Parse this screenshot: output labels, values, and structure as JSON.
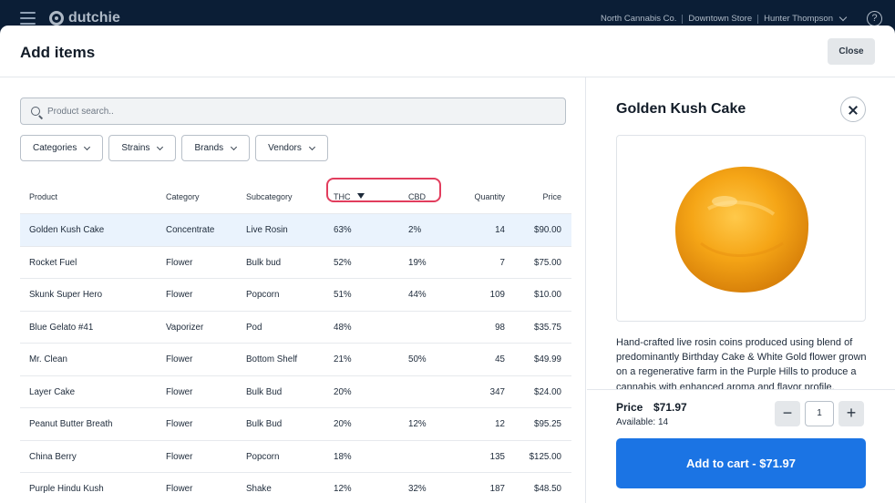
{
  "topbar": {
    "brand": "dutchie",
    "company": "North Cannabis Co.",
    "store": "Downtown Store",
    "user": "Hunter Thompson",
    "help_symbol": "?"
  },
  "modal": {
    "title": "Add items",
    "close_label": "Close"
  },
  "search": {
    "placeholder": "Product search.."
  },
  "filters": [
    "Categories",
    "Strains",
    "Brands",
    "Vendors"
  ],
  "table": {
    "columns": [
      "Product",
      "Category",
      "Subcategory",
      "THC",
      "CBD",
      "Quantity",
      "Price"
    ],
    "sorted_column": "THC",
    "rows": [
      {
        "product": "Golden Kush Cake",
        "category": "Concentrate",
        "subcategory": "Live Rosin",
        "thc": "63%",
        "cbd": "2%",
        "quantity": "14",
        "price": "$90.00"
      },
      {
        "product": "Rocket Fuel",
        "category": "Flower",
        "subcategory": "Bulk bud",
        "thc": "52%",
        "cbd": "19%",
        "quantity": "7",
        "price": "$75.00"
      },
      {
        "product": "Skunk Super Hero",
        "category": "Flower",
        "subcategory": "Popcorn",
        "thc": "51%",
        "cbd": "44%",
        "quantity": "109",
        "price": "$10.00"
      },
      {
        "product": "Blue Gelato #41",
        "category": "Vaporizer",
        "subcategory": "Pod",
        "thc": "48%",
        "cbd": "",
        "quantity": "98",
        "price": "$35.75"
      },
      {
        "product": "Mr. Clean",
        "category": "Flower",
        "subcategory": "Bottom Shelf",
        "thc": "21%",
        "cbd": "50%",
        "quantity": "45",
        "price": "$49.99"
      },
      {
        "product": "Layer Cake",
        "category": "Flower",
        "subcategory": "Bulk Bud",
        "thc": "20%",
        "cbd": "",
        "quantity": "347",
        "price": "$24.00"
      },
      {
        "product": "Peanut Butter Breath",
        "category": "Flower",
        "subcategory": "Bulk Bud",
        "thc": "20%",
        "cbd": "12%",
        "quantity": "12",
        "price": "$95.25"
      },
      {
        "product": "China Berry",
        "category": "Flower",
        "subcategory": "Popcorn",
        "thc": "18%",
        "cbd": "",
        "quantity": "135",
        "price": "$125.00"
      },
      {
        "product": "Purple Hindu Kush",
        "category": "Flower",
        "subcategory": "Shake",
        "thc": "12%",
        "cbd": "32%",
        "quantity": "187",
        "price": "$48.50"
      }
    ]
  },
  "detail": {
    "title": "Golden Kush Cake",
    "description": "Hand-crafted live rosin coins produced using  blend of predominantly Birthday Cake & White Gold flower grown on a regenerative farm in the Purple Hills to produce a cannabis with enhanced aroma and flavor profile.",
    "price_label": "Price",
    "price_value": "$71.97",
    "available": "Available:  14",
    "quantity": "1",
    "minus": "−",
    "plus": "+",
    "add_label": "Add to cart - $71.97"
  },
  "colors": {
    "topbar": "#0b1e36",
    "accent": "#1b74e4",
    "selected_row": "#eaf3fd",
    "highlight_ring": "#e23d5d",
    "product_image": "#f3a11a"
  },
  "icons": [
    "menu-icon",
    "dutchie-logo-icon",
    "chevron-down-icon",
    "help-icon",
    "search-icon",
    "close-icon",
    "sort-descending-icon"
  ]
}
